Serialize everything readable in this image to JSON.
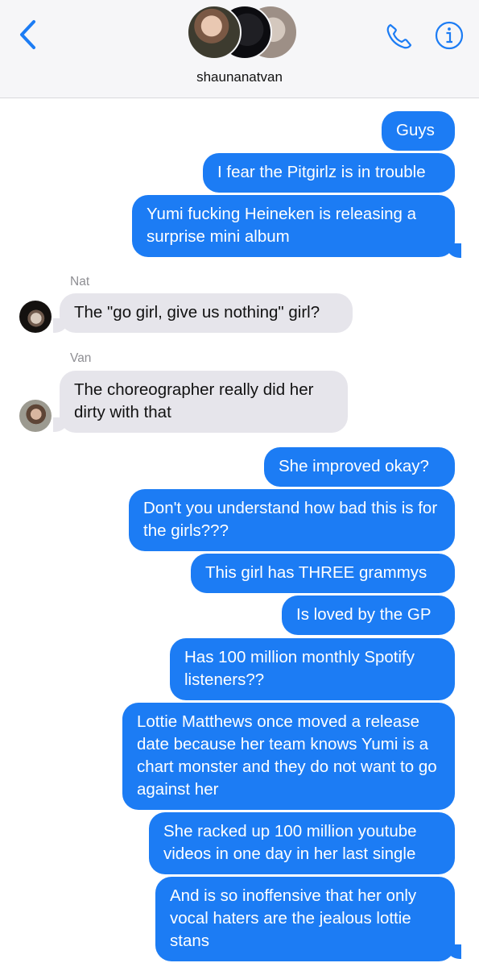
{
  "header": {
    "chat_name": "shaunanatvan",
    "icons": [
      "back-chevron-icon",
      "group-avatar",
      "phone-icon",
      "info-icon"
    ]
  },
  "colors": {
    "outgoing_bubble": "#1c7cf4",
    "incoming_bubble": "#e6e5eb",
    "accent": "#1c7cf4"
  },
  "messages": [
    {
      "text": "Guys"
    },
    {
      "text": "I fear the Pitgirlz is in trouble"
    },
    {
      "text": "Yumi fucking Heineken is releasing a surprise mini album"
    },
    {
      "sender": "Nat",
      "text": "The \"go girl, give us nothing\" girl?"
    },
    {
      "sender": "Van",
      "text": "The choreographer really did her dirty with that"
    },
    {
      "text": "She improved okay?"
    },
    {
      "text": "Don't you understand how bad this is for the girls???"
    },
    {
      "text": "This girl has THREE grammys"
    },
    {
      "text": "Is loved by the GP"
    },
    {
      "text": "Has 100 million monthly Spotify listeners??"
    },
    {
      "text": "Lottie Matthews once moved a release date because her team knows Yumi is a chart monster and they do not want to go against her"
    },
    {
      "text": "She racked up 100 million youtube videos in one day in her last single"
    },
    {
      "text": "And is so inoffensive that her only vocal haters are the jealous lottie stans"
    }
  ]
}
